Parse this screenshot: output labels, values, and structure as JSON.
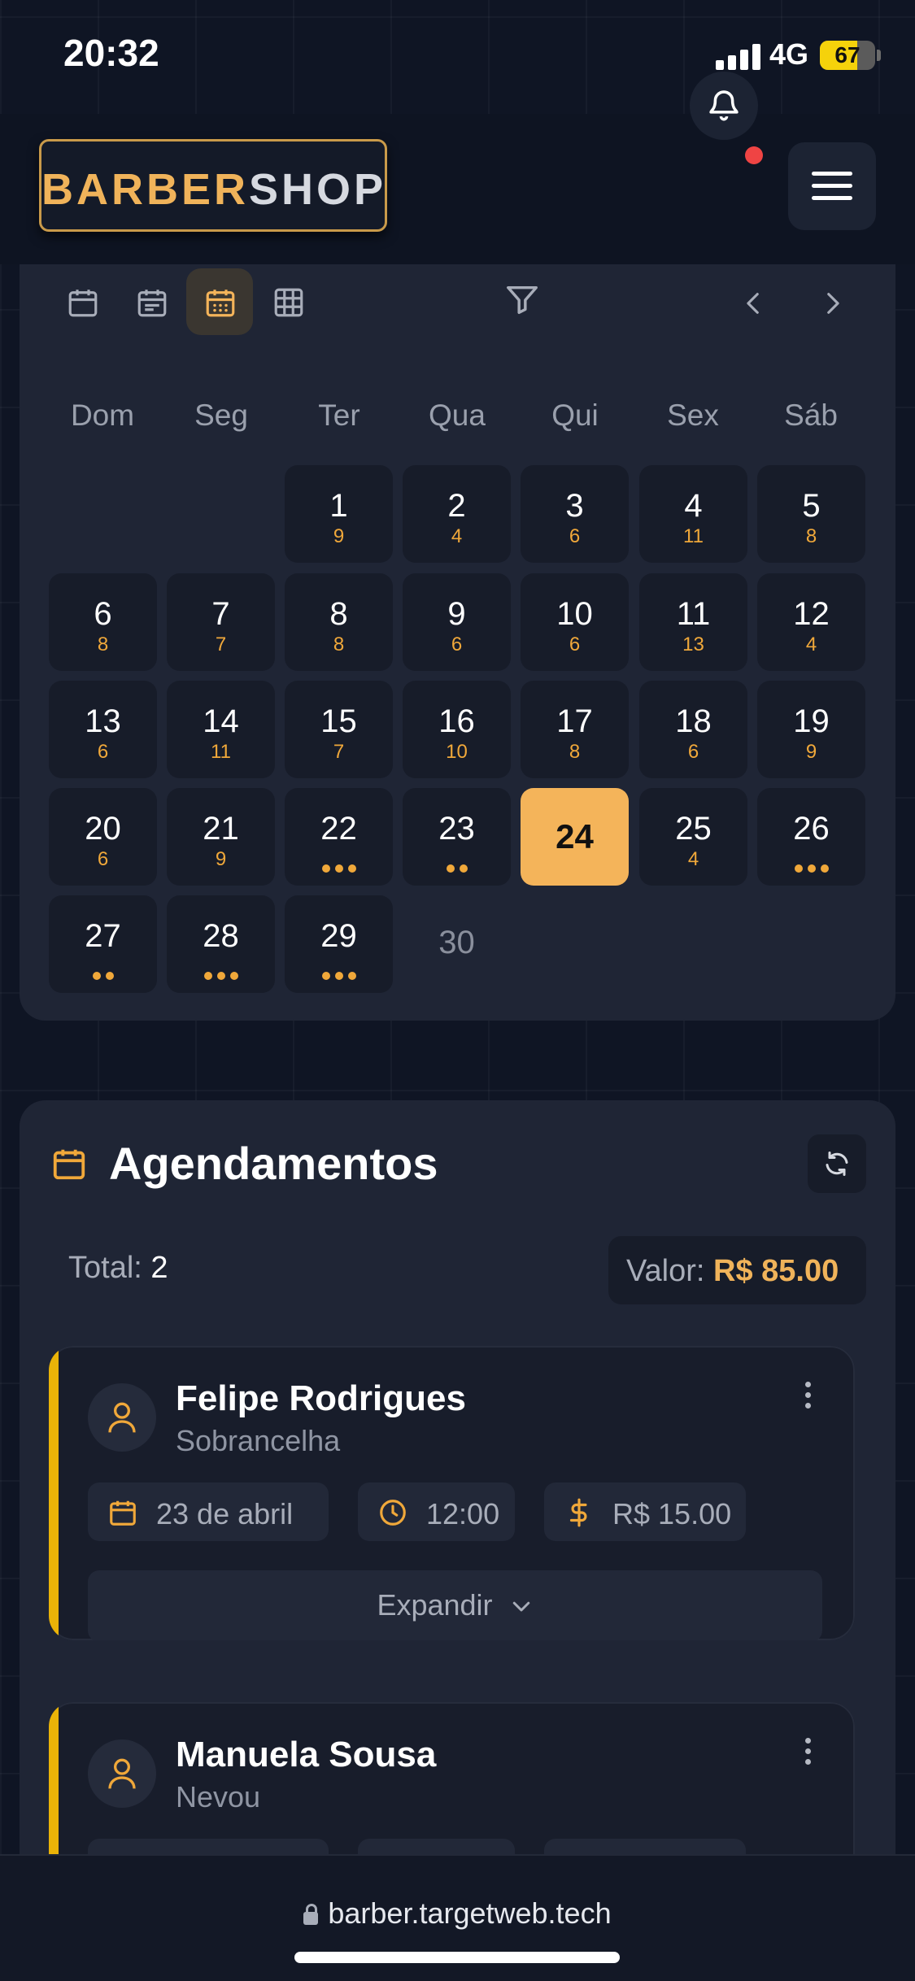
{
  "status_bar": {
    "time": "20:32",
    "network": "4G",
    "battery": "67",
    "battery_level": 0.67
  },
  "header": {
    "logo_part1": "BARBER",
    "logo_part2": "SHOP",
    "icons": [
      "bell-icon",
      "hamburger-menu-icon"
    ],
    "notification_dot_color": "#ef4444"
  },
  "calendar": {
    "view_icons": [
      "calendar-month-icon",
      "calendar-week-icon",
      "calendar-day-icon",
      "grid-icon"
    ],
    "active_view": 2,
    "weekdays": [
      "Dom",
      "Seg",
      "Ter",
      "Qua",
      "Qui",
      "Sex",
      "Sáb"
    ],
    "days": [
      {
        "day": "1",
        "count": "9"
      },
      {
        "day": "2",
        "count": "4"
      },
      {
        "day": "3",
        "count": "6"
      },
      {
        "day": "4",
        "count": "11"
      },
      {
        "day": "5",
        "count": "8"
      },
      {
        "day": "6",
        "count": "8"
      },
      {
        "day": "7",
        "count": "7"
      },
      {
        "day": "8",
        "count": "8"
      },
      {
        "day": "9",
        "count": "6"
      },
      {
        "day": "10",
        "count": "6"
      },
      {
        "day": "11",
        "count": "13"
      },
      {
        "day": "12",
        "count": "4"
      },
      {
        "day": "13",
        "count": "6"
      },
      {
        "day": "14",
        "count": "11"
      },
      {
        "day": "15",
        "count": "7"
      },
      {
        "day": "16",
        "count": "10"
      },
      {
        "day": "17",
        "count": "8"
      },
      {
        "day": "18",
        "count": "6"
      },
      {
        "day": "19",
        "count": "9"
      },
      {
        "day": "20",
        "count": "6"
      },
      {
        "day": "21",
        "count": "9"
      },
      {
        "day": "22",
        "dots": 3
      },
      {
        "day": "23",
        "dots": 2
      },
      {
        "day": "24",
        "selected": true
      },
      {
        "day": "25",
        "count": "4"
      },
      {
        "day": "26",
        "dots": 3
      },
      {
        "day": "27",
        "dots": 2
      },
      {
        "day": "28",
        "dots": 3
      },
      {
        "day": "29",
        "dots": 3
      },
      {
        "day": "30",
        "outside": true
      }
    ],
    "first_weekday": 2,
    "accent": "#f4b45a"
  },
  "appointments": {
    "title": "Agendamentos",
    "total_label": "Total:",
    "total_value": "2",
    "valor_label": "Valor:",
    "valor_value": "R$ 85.00",
    "items": [
      {
        "name": "Felipe Rodrigues",
        "service": "Sobrancelha",
        "date": "23 de abril",
        "time": "12:00",
        "price": "R$ 15.00",
        "expand_label": "Expandir"
      },
      {
        "name": "Manuela Sousa",
        "service": "Nevou"
      }
    ]
  },
  "browser": {
    "url": "barber.targetweb.tech"
  }
}
